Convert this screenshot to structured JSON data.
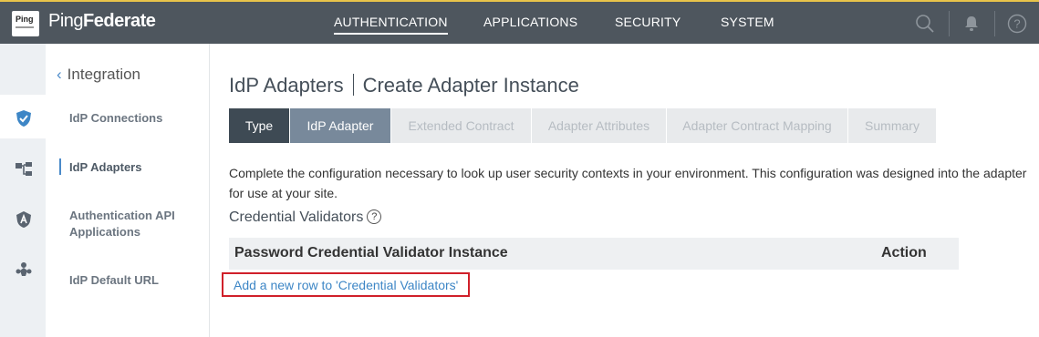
{
  "app": {
    "logo_text": "Ping",
    "brand_light": "Ping",
    "brand_bold": "Federate"
  },
  "nav": {
    "items": [
      {
        "label": "AUTHENTICATION",
        "active": true
      },
      {
        "label": "APPLICATIONS"
      },
      {
        "label": "SECURITY"
      },
      {
        "label": "SYSTEM"
      }
    ],
    "help_glyph": "?"
  },
  "sidebar": {
    "back_label": "Integration",
    "items": [
      {
        "label": "IdP Connections"
      },
      {
        "label": "IdP Adapters",
        "active": true
      },
      {
        "label": "Authentication API Applications"
      },
      {
        "label": "IdP Default URL"
      }
    ],
    "rail_icons": [
      "shield-check-icon",
      "hierarchy-icon",
      "badge-icon",
      "people-icon"
    ]
  },
  "page": {
    "title_main": "IdP Adapters",
    "title_sub": "Create Adapter Instance",
    "tabs": [
      {
        "label": "Type",
        "state": "done"
      },
      {
        "label": "IdP Adapter",
        "state": "current"
      },
      {
        "label": "Extended Contract"
      },
      {
        "label": "Adapter Attributes"
      },
      {
        "label": "Adapter Contract Mapping"
      },
      {
        "label": "Summary"
      }
    ],
    "description": "Complete the configuration necessary to look up user security contexts in your environment. This configuration was designed into the adapter for use at your site.",
    "section_title": "Credential Validators",
    "help_glyph": "?",
    "table": {
      "col1": "Password Credential Validator Instance",
      "col2": "Action"
    },
    "add_row_link": "Add a new row to 'Credential Validators'"
  },
  "colors": {
    "topbar": "#4e565e",
    "accent_blue": "#4a8ac9",
    "highlight_red": "#d0202a"
  }
}
